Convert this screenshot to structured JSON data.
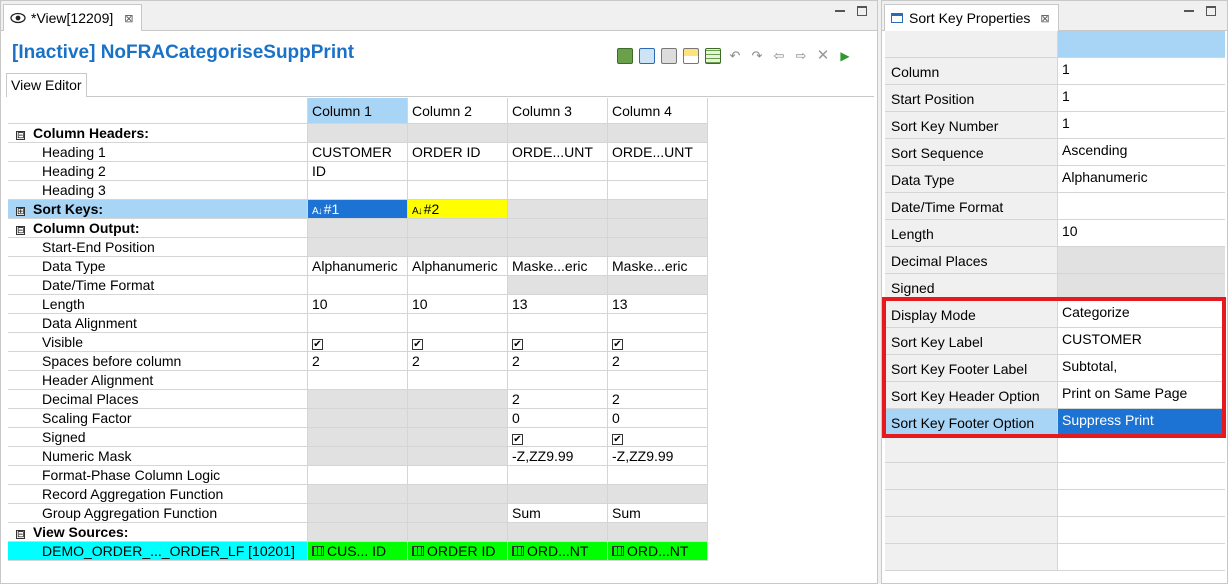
{
  "view_tab": {
    "label": "*View[12209]",
    "close": "⊠"
  },
  "view_title": "[Inactive] NoFRACategoriseSuppPrint",
  "subtab": "View Editor",
  "grid": {
    "columns": [
      "Column 1",
      "Column 2",
      "Column 3",
      "Column 4"
    ],
    "rows": [
      {
        "label": "Column Headers:",
        "type": "section",
        "toggle": "⊟",
        "values": [
          "",
          "",
          "",
          ""
        ],
        "grey": true
      },
      {
        "label": "Heading 1",
        "type": "item",
        "values": [
          "CUSTOMER",
          "ORDER ID",
          "ORDE...UNT",
          "ORDE...UNT"
        ]
      },
      {
        "label": "Heading 2",
        "type": "item",
        "values": [
          "ID",
          "",
          "",
          ""
        ]
      },
      {
        "label": "Heading 3",
        "type": "item",
        "values": [
          "",
          "",
          "",
          ""
        ]
      },
      {
        "label": "Sort Keys:",
        "type": "sortsection",
        "toggle": "⊞",
        "values": [
          "#1",
          "#2",
          "",
          ""
        ]
      },
      {
        "label": "Column Output:",
        "type": "section",
        "toggle": "⊟",
        "values": [
          "",
          "",
          "",
          ""
        ],
        "grey": true
      },
      {
        "label": "Start-End  Position",
        "type": "item",
        "values": [
          "",
          "",
          "",
          ""
        ],
        "grey": true
      },
      {
        "label": "Data Type",
        "type": "item",
        "values": [
          "Alphanumeric",
          "Alphanumeric",
          "Maske...eric",
          "Maske...eric"
        ]
      },
      {
        "label": "Date/Time Format",
        "type": "item",
        "values": [
          "",
          "",
          "",
          ""
        ],
        "greycols": [
          2,
          3
        ]
      },
      {
        "label": "Length",
        "type": "item",
        "values": [
          "10",
          "10",
          "13",
          "13"
        ]
      },
      {
        "label": "Data Alignment",
        "type": "item",
        "values": [
          "",
          "",
          "",
          ""
        ]
      },
      {
        "label": "Visible",
        "type": "item",
        "values": [
          "✔",
          "✔",
          "✔",
          "✔"
        ],
        "check": true
      },
      {
        "label": "Spaces before column",
        "type": "item",
        "values": [
          "2",
          "2",
          "2",
          "2"
        ]
      },
      {
        "label": "Header Alignment",
        "type": "item",
        "values": [
          "",
          "",
          "",
          ""
        ]
      },
      {
        "label": "Decimal Places",
        "type": "item",
        "values": [
          "",
          "",
          "2",
          "2"
        ],
        "greycols": [
          0,
          1
        ]
      },
      {
        "label": "Scaling Factor",
        "type": "item",
        "values": [
          "",
          "",
          "0",
          "0"
        ],
        "greycols": [
          0,
          1
        ]
      },
      {
        "label": "Signed",
        "type": "item",
        "values": [
          "",
          "",
          "✔",
          "✔"
        ],
        "greycols": [
          0,
          1
        ],
        "check": true
      },
      {
        "label": "Numeric Mask",
        "type": "item",
        "values": [
          "",
          "",
          "-Z,ZZ9.99",
          "-Z,ZZ9.99"
        ],
        "greycols": [
          0,
          1
        ]
      },
      {
        "label": "Format-Phase Column Logic",
        "type": "item",
        "values": [
          "",
          "",
          "",
          ""
        ]
      },
      {
        "label": "Record Aggregation Function",
        "type": "item",
        "values": [
          "",
          "",
          "",
          ""
        ],
        "grey": true
      },
      {
        "label": "Group Aggregation Function",
        "type": "item",
        "values": [
          "",
          "",
          "Sum",
          "Sum"
        ],
        "greycols": [
          0,
          1
        ]
      },
      {
        "label": "View Sources:",
        "type": "section",
        "toggle": "⊟",
        "values": [
          "",
          "",
          "",
          ""
        ],
        "grey": true
      },
      {
        "label": "DEMO_ORDER_..._ORDER_LF [10201]",
        "type": "source",
        "values": [
          "CUS... ID",
          "ORDER ID",
          "ORD...NT",
          "ORD...NT"
        ]
      }
    ]
  },
  "props_tab": {
    "label": "Sort Key Properties",
    "close": "⊠"
  },
  "properties": [
    {
      "key": "Column",
      "value": "1"
    },
    {
      "key": "Start Position",
      "value": "1"
    },
    {
      "key": "Sort Key Number",
      "value": "1"
    },
    {
      "key": "Sort Sequence",
      "value": "Ascending"
    },
    {
      "key": "Data Type",
      "value": "Alphanumeric"
    },
    {
      "key": "Date/Time Format",
      "value": ""
    },
    {
      "key": "Length",
      "value": "10"
    },
    {
      "key": "Decimal Places",
      "value": "",
      "grey": true
    },
    {
      "key": "Signed",
      "value": "",
      "grey": true
    },
    {
      "key": "Display Mode",
      "value": "Categorize"
    },
    {
      "key": "Sort Key Label",
      "value": "CUSTOMER"
    },
    {
      "key": "Sort Key Footer Label",
      "value": "Subtotal,"
    },
    {
      "key": "Sort Key Header Option",
      "value": "Print on Same Page"
    },
    {
      "key": "Sort Key Footer Option",
      "value": "Suppress Print",
      "selected": true
    },
    {
      "key": "",
      "value": ""
    },
    {
      "key": "",
      "value": ""
    },
    {
      "key": "",
      "value": ""
    },
    {
      "key": "",
      "value": ""
    },
    {
      "key": "",
      "value": ""
    }
  ],
  "colors": {
    "accent": "#1a72c7",
    "selection": "#1c73d3",
    "highlight": "#e6191f",
    "sort_key_2": "#ffff00",
    "source_row": "#00ffff",
    "source_cells": "#00ff00"
  }
}
